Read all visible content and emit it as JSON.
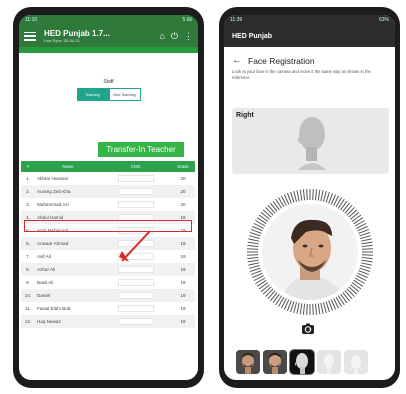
{
  "left": {
    "status_bar": {
      "time": "11:10",
      "right": "5.6k"
    },
    "appbar": {
      "title": "HED Punjab 1.7...",
      "subtitle": "Last Sync: 30-04-21"
    },
    "section_title": "Staff",
    "toggle": {
      "active": "Teaching",
      "inactive": "Non-Teaching"
    },
    "transfer_button": "Transfer-In Teacher",
    "table": {
      "headers": [
        "#",
        "Name",
        "CNIC",
        "Grade"
      ],
      "rows": [
        {
          "idx": "1.",
          "name": "Akhtar Hussain",
          "grade": "20"
        },
        {
          "idx": "2.",
          "name": "Aurang Zeb Kha",
          "grade": "20"
        },
        {
          "idx": "3.",
          "name": "Muhammad Azi",
          "grade": "20"
        },
        {
          "idx": "4.",
          "name": "Abdul Hamid",
          "grade": "19"
        },
        {
          "idx": "5.",
          "name": "Amir Mahmood",
          "grade": "19"
        },
        {
          "idx": "6.",
          "name": "Anwaar Ahmad",
          "grade": "19"
        },
        {
          "idx": "7.",
          "name": "Asif Ali",
          "grade": "19"
        },
        {
          "idx": "8.",
          "name": "Azhar Ali",
          "grade": "19"
        },
        {
          "idx": "9.",
          "name": "Basit Ali",
          "grade": "19"
        },
        {
          "idx": "10.",
          "name": "Daniel",
          "grade": "19"
        },
        {
          "idx": "11.",
          "name": "Faisal Elahi Butt",
          "grade": "19"
        },
        {
          "idx": "12.",
          "name": "Haq Nawaz",
          "grade": "19"
        }
      ]
    },
    "colors": {
      "appbar": "#2f7a3a",
      "accent": "#35b547",
      "highlight": "#d62b2b"
    }
  },
  "right": {
    "status_bar": {
      "time": "11:39",
      "right": "63%"
    },
    "appbar": {
      "title": "HED Punjab"
    },
    "header": {
      "title": "Face Registration",
      "back_icon": "back-arrow-icon"
    },
    "description": "Look at your face in the camera and move it the same way as shown in the reference",
    "reference": {
      "label": "Right"
    },
    "rotate_icon": "rotate-camera-icon",
    "thumbnails": [
      "face-front",
      "face-left",
      "face-right-selected",
      "face-up-pending",
      "face-down-pending"
    ]
  }
}
